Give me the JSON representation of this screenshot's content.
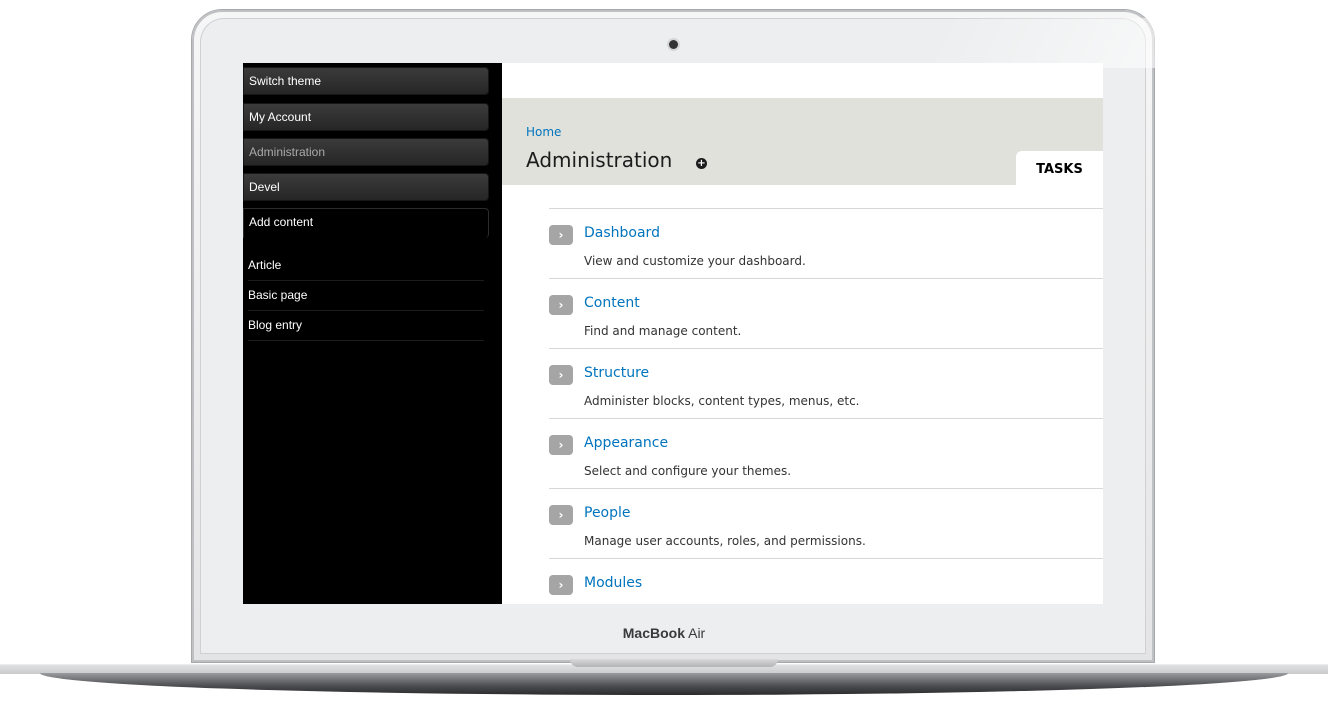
{
  "device": {
    "brand_bold": "MacBook",
    "brand_light": "Air"
  },
  "sidebar": {
    "menu": [
      {
        "label": "Switch theme"
      },
      {
        "label": "My Account"
      },
      {
        "label": "Administration"
      },
      {
        "label": "Devel"
      },
      {
        "label": "Add content"
      }
    ],
    "submenu": [
      {
        "label": "Article"
      },
      {
        "label": "Basic page"
      },
      {
        "label": "Blog entry"
      }
    ]
  },
  "main": {
    "breadcrumb": "Home",
    "title": "Administration",
    "add_icon": "plus-circle-icon",
    "tab": "TASKS",
    "tasks": [
      {
        "title": "Dashboard",
        "description": "View and customize your dashboard."
      },
      {
        "title": "Content",
        "description": "Find and manage content."
      },
      {
        "title": "Structure",
        "description": "Administer blocks, content types, menus, etc."
      },
      {
        "title": "Appearance",
        "description": "Select and configure your themes."
      },
      {
        "title": "People",
        "description": "Manage user accounts, roles, and permissions."
      },
      {
        "title": "Modules",
        "description": ""
      }
    ]
  },
  "colors": {
    "link": "#0074bd",
    "header_band": "#e1e1dc",
    "sidebar": "#000000"
  }
}
